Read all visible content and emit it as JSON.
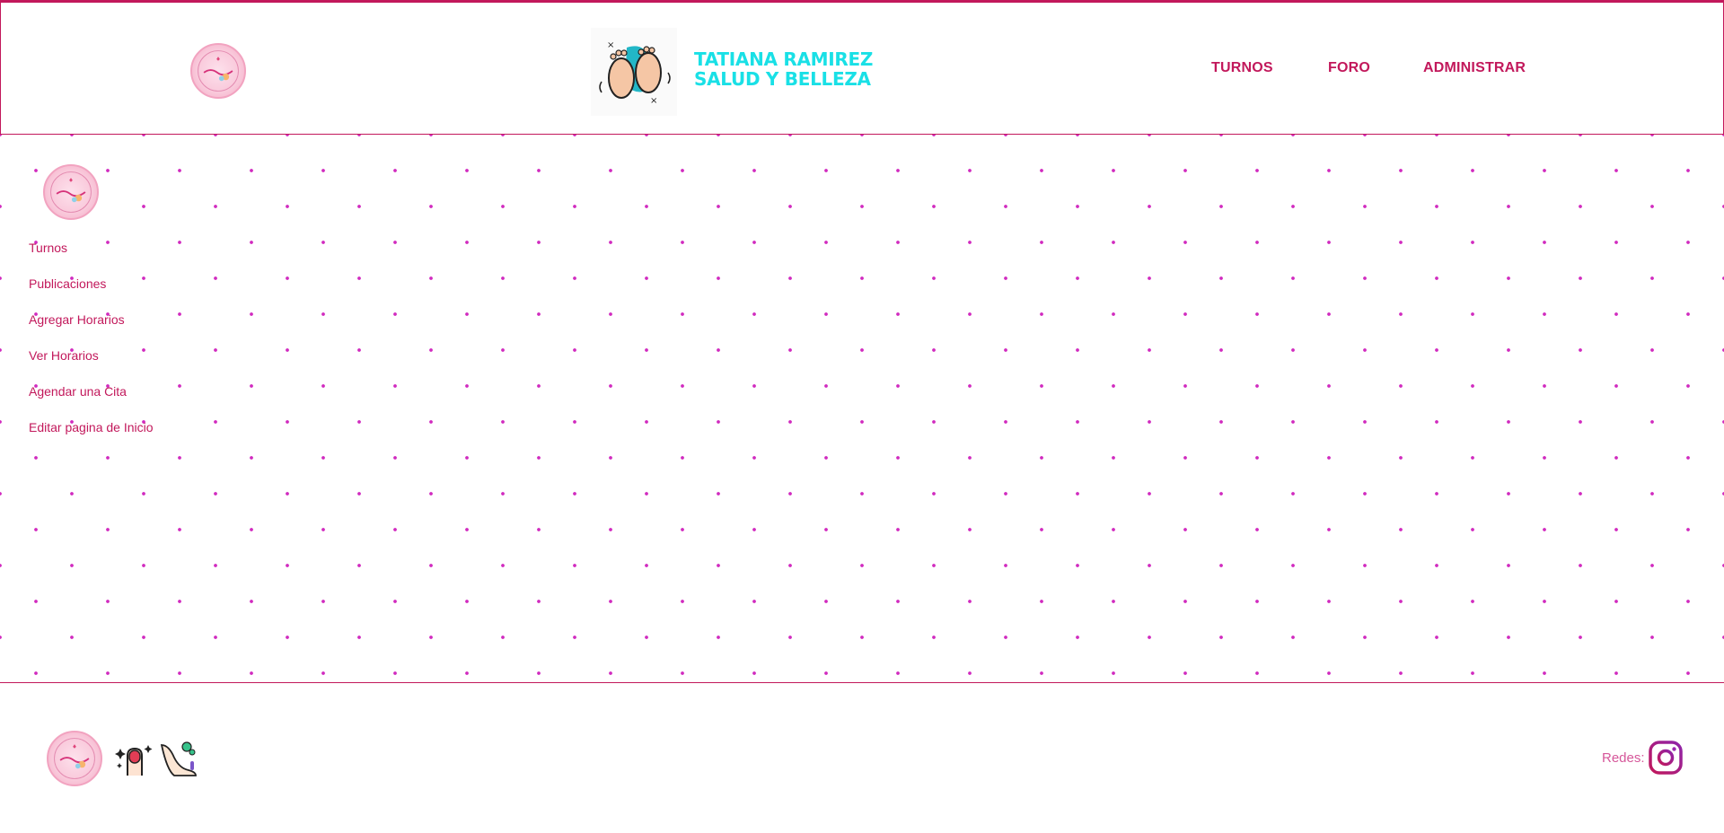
{
  "header": {
    "brand_line1": "TATIANA RAMIREZ",
    "brand_line2": "SALUD Y BELLEZA",
    "nav": {
      "turnos": "TURNOS",
      "foro": "FORO",
      "administrar": "ADMINISTRAR"
    }
  },
  "sidebar": {
    "items": [
      {
        "label": "Turnos"
      },
      {
        "label": "Publicaciones"
      },
      {
        "label": "Agregar Horarios"
      },
      {
        "label": "Ver Horarios"
      },
      {
        "label": "Agendar una Cita"
      },
      {
        "label": "Editar pagina de Inicio"
      }
    ]
  },
  "footer": {
    "redes_label": "Redes:"
  },
  "colors": {
    "accent": "#c2185b",
    "brand_text": "#19e0e6",
    "dot_pattern": "#d12bbf",
    "seal_pink": "#f9c8da"
  },
  "icons": {
    "logo_seal": "logo-seal-icon",
    "feet": "baby-feet-icon",
    "nail": "nail-polish-icon",
    "foot_care": "foot-care-icon",
    "instagram": "instagram-icon"
  }
}
